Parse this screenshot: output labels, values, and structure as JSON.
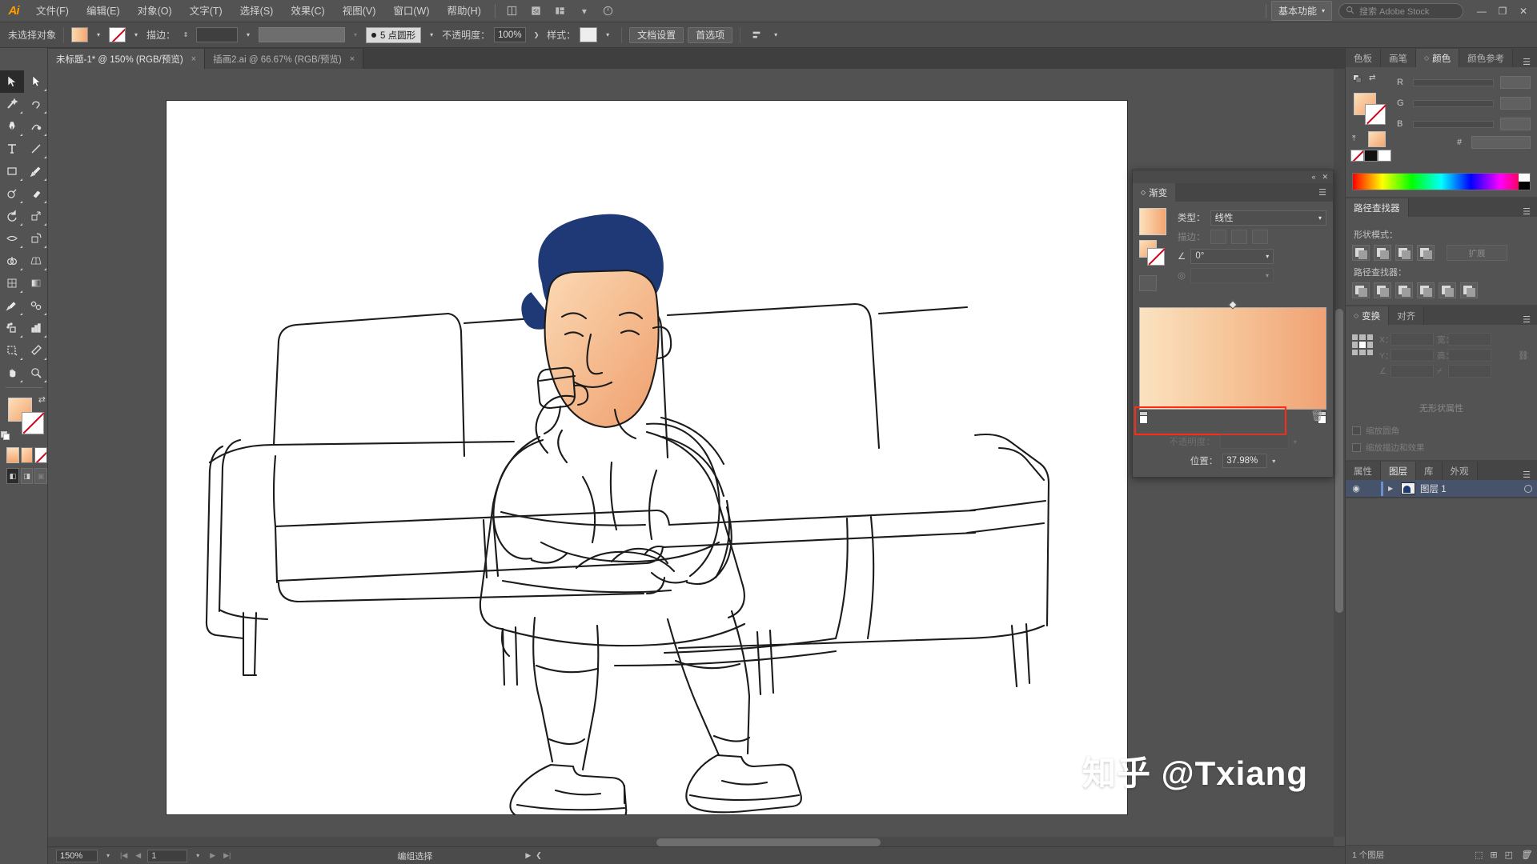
{
  "app": {
    "name": "Adobe Illustrator",
    "logo_text": "Ai"
  },
  "menubar": {
    "items": [
      "文件(F)",
      "编辑(E)",
      "对象(O)",
      "文字(T)",
      "选择(S)",
      "效果(C)",
      "视图(V)",
      "窗口(W)",
      "帮助(H)"
    ],
    "icons": [
      "bridge-icon",
      "stock-icon",
      "arrange-documents-icon",
      "chevron-down-icon",
      "cc-home-icon"
    ],
    "workspace": "基本功能",
    "stock_search_placeholder": "搜索 Adobe Stock",
    "window_buttons": [
      "minimize-button",
      "restore-button",
      "close-button"
    ]
  },
  "controlbar": {
    "selection_status": "未选择对象",
    "fill_label": "fill-swatch",
    "stroke_label": "stroke-swatch",
    "stroke_text": "描边：",
    "stroke_weight": "",
    "brush_definition": "5 点圆形",
    "opacity_label": "不透明度：",
    "opacity_value": "100%",
    "style_label": "样式：",
    "doc_setup": "文档设置",
    "preferences": "首选项",
    "align_icon": "align-icon"
  },
  "tabs": [
    {
      "title": "未标题-1* @ 150% (RGB/预览)",
      "active": true,
      "close": "×"
    },
    {
      "title": "插画2.ai @ 66.67% (RGB/预览)",
      "active": false,
      "close": "×"
    }
  ],
  "toolbar": {
    "tools": [
      "selection-tool",
      "direct-selection-tool",
      "magic-wand-tool",
      "lasso-tool",
      "pen-tool",
      "curvature-tool",
      "type-tool",
      "line-segment-tool",
      "rectangle-tool",
      "paintbrush-tool",
      "shaper-tool",
      "eraser-tool",
      "rotate-tool",
      "scale-tool",
      "width-tool",
      "free-transform-tool",
      "shape-builder-tool",
      "perspective-grid-tool",
      "mesh-tool",
      "gradient-tool",
      "eyedropper-tool",
      "blend-tool",
      "symbol-sprayer-tool",
      "column-graph-tool",
      "artboard-tool",
      "slice-tool",
      "hand-tool",
      "zoom-tool"
    ],
    "fill_stroke": {
      "fill": "gradient-fill-swatch",
      "stroke": "none-stroke-swatch",
      "swap": "swap-fill-stroke-icon",
      "default": "default-fill-stroke-icon"
    },
    "fill_modes": [
      "gradient-mode",
      "color-mode",
      "none-mode"
    ],
    "screen_modes": [
      "normal-screen-mode",
      "full-screen-menu-mode",
      "full-screen-mode"
    ]
  },
  "canvas": {
    "artwork_name": "man-sitting-on-sofa-line-art",
    "watermark": "知乎 @Txiang"
  },
  "statusbar": {
    "zoom": "150%",
    "page": "1",
    "status_text": "编组选择",
    "nav_first": "first-page-icon",
    "nav_prev": "prev-page-icon",
    "nav_next": "next-page-icon",
    "nav_last": "last-page-icon"
  },
  "dock": {
    "color_panel": {
      "tabs": [
        "色板",
        "画笔",
        "颜色",
        "颜色参考"
      ],
      "active_tab": "颜色",
      "channels": [
        "R",
        "G",
        "B"
      ],
      "hex_label": "#"
    },
    "pathfinder_panel": {
      "tabs": [
        "路径查找器"
      ],
      "shape_modes_label": "形状模式：",
      "pathfinder_label": "路径查找器：",
      "expand_label": "扩展",
      "shape_mode_buttons": [
        "unite-icon",
        "minus-front-icon",
        "intersect-icon",
        "exclude-icon"
      ],
      "pathfinder_buttons": [
        "divide-icon",
        "trim-icon",
        "merge-icon",
        "crop-icon",
        "outline-icon",
        "minus-back-icon"
      ]
    },
    "transform_panel": {
      "tabs": [
        "变换",
        "对齐"
      ],
      "active_tab": "变换",
      "fields": [
        "X：",
        "Y：",
        "宽：",
        "高："
      ],
      "angle_label": "角度",
      "shear_label": "斜切",
      "link_icon": "constrain-proportions-icon"
    },
    "appearance_area": {
      "no_shape_text": "无形状属性",
      "checkbox1": "缩放圆角",
      "checkbox2": "缩放描边和效果"
    },
    "layers_panel": {
      "tabs": [
        "属性",
        "图层",
        "库",
        "外观"
      ],
      "active_tab": "图层",
      "layers": [
        {
          "name": "图层 1",
          "visible": true,
          "locked": false,
          "selected": true
        }
      ],
      "footer_count": "1 个图层",
      "footer_icons": [
        "make-clipping-mask-icon",
        "create-sublayer-icon",
        "create-new-layer-icon",
        "delete-layer-icon"
      ]
    }
  },
  "gradient_panel": {
    "title": "渐变",
    "type_label": "类型：",
    "type_value": "线性",
    "stroke_label": "描边：",
    "angle_label": "angle-icon",
    "angle_value": "0°",
    "aspect_label": "aspect-ratio-icon",
    "opacity_label": "不透明度：",
    "position_label": "位置：",
    "position_value": "37.98%",
    "gradient_colors": [
      "#fbe2c0",
      "#f0a273"
    ],
    "stops": [
      {
        "position": 0,
        "color": "#fbe2c0"
      },
      {
        "position": 100,
        "color": "#f0a273"
      }
    ],
    "midpoint": 50,
    "highlight_color": "#ff2b16",
    "delete_stop_icon": "trash-icon",
    "collapse_icon": "collapse-icon",
    "close_icon": "close-icon",
    "menu_icon": "panel-menu-icon"
  }
}
